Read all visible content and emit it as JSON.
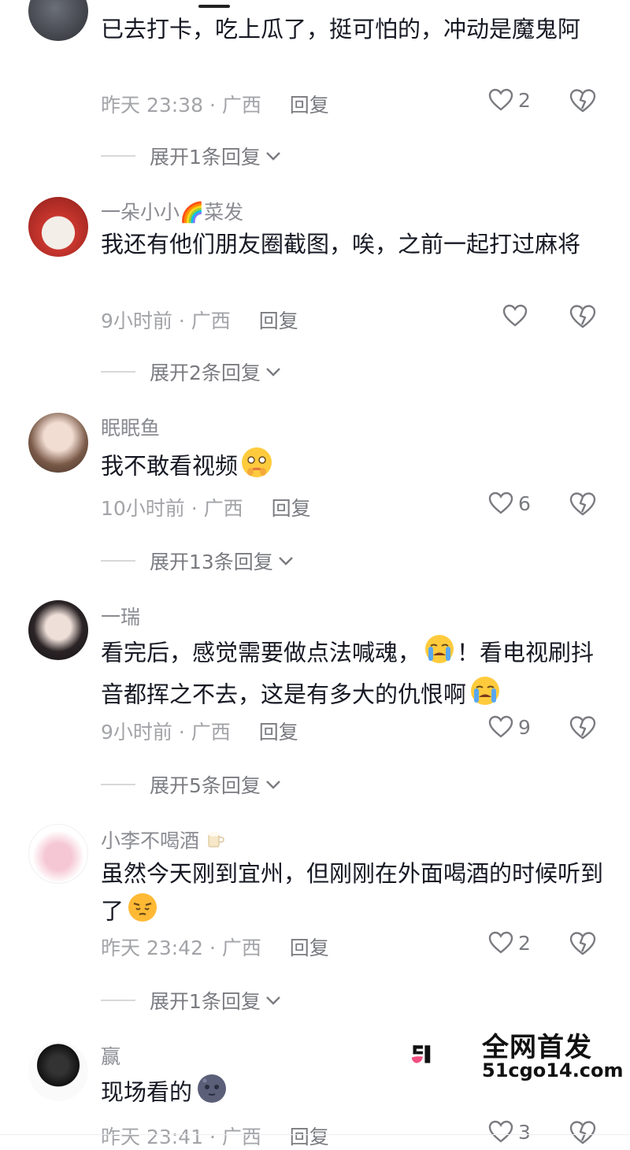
{
  "comments": [
    {
      "username": "",
      "text": "已去打卡，吃上瓜了，挺可怕的，冲动是魔鬼阿",
      "time": "昨天 23:38 · 广西",
      "reply": "回复",
      "likes": "2",
      "expand": "展开1条回复"
    },
    {
      "username": "一朵小小🌈菜发",
      "text": "我还有他们朋友圈截图，唉，之前一起打过麻将",
      "time": "9小时前 · 广西",
      "reply": "回复",
      "likes": "",
      "expand": "展开2条回复"
    },
    {
      "username": "眠眠鱼",
      "text": "我不敢看视频",
      "time": "10小时前 · 广西",
      "reply": "回复",
      "likes": "6",
      "expand": "展开13条回复"
    },
    {
      "username": "一瑞",
      "text": "看完后，感觉需要做点法喊魂，",
      "text2": "！看电视刷抖音都挥之不去，这是有多大的仇恨啊",
      "time": "9小时前 · 广西",
      "reply": "回复",
      "likes": "9",
      "expand": "展开5条回复"
    },
    {
      "username": "小李不喝酒",
      "text": "虽然今天刚到宜州，但刚刚在外面喝酒的时候听到了",
      "time": "昨天 23:42 · 广西",
      "reply": "回复",
      "likes": "2",
      "expand": "展开1条回复"
    },
    {
      "username": "赢",
      "text": "现场看的",
      "time": "昨天 23:41 · 广西",
      "reply": "回复",
      "likes": "3"
    }
  ],
  "watermark": {
    "title": "全网首发",
    "url": "51cgo14.com"
  },
  "icons": [
    "heart-icon",
    "dislike-heart-icon",
    "chevron-down-icon"
  ],
  "colors": {
    "text": "#161823",
    "meta": "#a3a4a8",
    "accent_pink": "#f04f7f"
  }
}
